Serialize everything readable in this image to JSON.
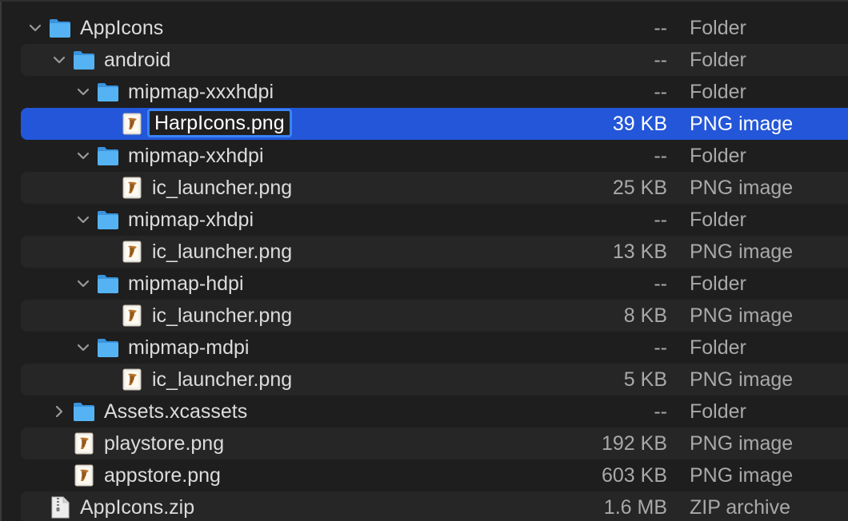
{
  "rows": [
    {
      "name": "AppIcons",
      "size": "--",
      "kind": "Folder",
      "type": "folder",
      "disclosure": "expanded",
      "depth": 0,
      "alt": false,
      "selected": false
    },
    {
      "name": "android",
      "size": "--",
      "kind": "Folder",
      "type": "folder",
      "disclosure": "expanded",
      "depth": 1,
      "alt": true,
      "selected": false
    },
    {
      "name": "mipmap-xxxhdpi",
      "size": "--",
      "kind": "Folder",
      "type": "folder",
      "disclosure": "expanded",
      "depth": 2,
      "alt": false,
      "selected": false
    },
    {
      "name": "HarpIcons.png",
      "size": "39 KB",
      "kind": "PNG image",
      "type": "png",
      "disclosure": "none",
      "depth": 3,
      "alt": true,
      "selected": true,
      "editing": true
    },
    {
      "name": "mipmap-xxhdpi",
      "size": "--",
      "kind": "Folder",
      "type": "folder",
      "disclosure": "expanded",
      "depth": 2,
      "alt": false,
      "selected": false
    },
    {
      "name": "ic_launcher.png",
      "size": "25 KB",
      "kind": "PNG image",
      "type": "png",
      "disclosure": "none",
      "depth": 3,
      "alt": true,
      "selected": false
    },
    {
      "name": "mipmap-xhdpi",
      "size": "--",
      "kind": "Folder",
      "type": "folder",
      "disclosure": "expanded",
      "depth": 2,
      "alt": false,
      "selected": false
    },
    {
      "name": "ic_launcher.png",
      "size": "13 KB",
      "kind": "PNG image",
      "type": "png",
      "disclosure": "none",
      "depth": 3,
      "alt": true,
      "selected": false
    },
    {
      "name": "mipmap-hdpi",
      "size": "--",
      "kind": "Folder",
      "type": "folder",
      "disclosure": "expanded",
      "depth": 2,
      "alt": false,
      "selected": false
    },
    {
      "name": "ic_launcher.png",
      "size": "8 KB",
      "kind": "PNG image",
      "type": "png",
      "disclosure": "none",
      "depth": 3,
      "alt": true,
      "selected": false
    },
    {
      "name": "mipmap-mdpi",
      "size": "--",
      "kind": "Folder",
      "type": "folder",
      "disclosure": "expanded",
      "depth": 2,
      "alt": false,
      "selected": false
    },
    {
      "name": "ic_launcher.png",
      "size": "5 KB",
      "kind": "PNG image",
      "type": "png",
      "disclosure": "none",
      "depth": 3,
      "alt": true,
      "selected": false
    },
    {
      "name": "Assets.xcassets",
      "size": "--",
      "kind": "Folder",
      "type": "folder",
      "disclosure": "collapsed",
      "depth": 1,
      "alt": false,
      "selected": false
    },
    {
      "name": "playstore.png",
      "size": "192 KB",
      "kind": "PNG image",
      "type": "png",
      "disclosure": "none",
      "depth": 1,
      "alt": true,
      "selected": false
    },
    {
      "name": "appstore.png",
      "size": "603 KB",
      "kind": "PNG image",
      "type": "png",
      "disclosure": "none",
      "depth": 1,
      "alt": false,
      "selected": false
    },
    {
      "name": "AppIcons.zip",
      "size": "1.6 MB",
      "kind": "ZIP archive",
      "type": "zip",
      "disclosure": "none",
      "depth": 0,
      "alt": true,
      "selected": false
    }
  ],
  "colors": {
    "background": "#1e1e1e",
    "alternate_row": "#262626",
    "selection": "#2356d8",
    "folder_blue": "#4aa6ee",
    "text": "#dcdcdc",
    "secondary_text": "#a9a9a9"
  }
}
